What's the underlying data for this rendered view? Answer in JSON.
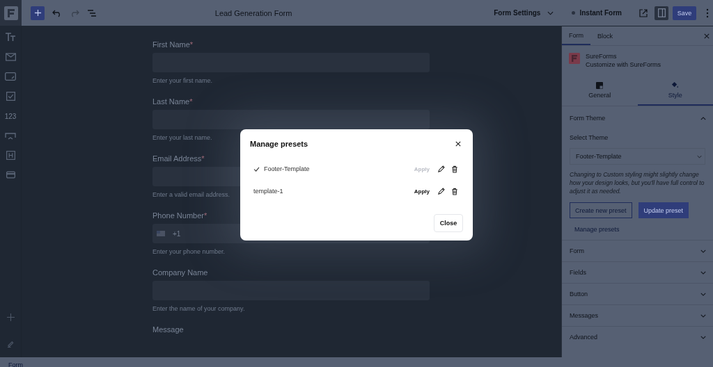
{
  "toolbar": {
    "title": "Lead Generation Form",
    "undo_disabled": false,
    "redo_disabled": true,
    "form_settings": "Form Settings",
    "instant_form": "Instant Form",
    "panel_toggle_on": true,
    "save": "Save"
  },
  "rail": [
    {
      "kind": "text"
    },
    {
      "kind": "mail"
    },
    {
      "kind": "textarea"
    },
    {
      "kind": "checkbox"
    },
    {
      "kind": "label",
      "text": "123"
    },
    {
      "kind": "dropdown"
    },
    {
      "kind": "heading"
    },
    {
      "kind": "payment"
    }
  ],
  "form": {
    "fields": [
      {
        "label": "First Name",
        "marker": "*",
        "kind": "text",
        "help": "Enter your first name."
      },
      {
        "label": "Last Name",
        "marker": "*",
        "kind": "text",
        "help": "Enter your last name."
      },
      {
        "label": "Email Address",
        "marker": "*",
        "kind": "text",
        "help": "Enter a valid email address."
      },
      {
        "label": "Phone Number",
        "marker": "*",
        "kind": "phone",
        "prefix": "+1",
        "help": "Enter your phone number."
      },
      {
        "label": "Company Name",
        "kind": "text",
        "help": "Enter the name of your company."
      },
      {
        "label": "Message",
        "kind": "label-only"
      }
    ]
  },
  "footer": {
    "breadcrumb": "Form"
  },
  "dialog": {
    "title": "Manage presets",
    "presets": [
      {
        "name": "Footer-Template",
        "selected": true,
        "apply": "Apply"
      },
      {
        "name": "template-1",
        "selected": false,
        "apply": "Apply"
      }
    ],
    "close_button": "Close"
  },
  "panel": {
    "tabs": [
      {
        "label": "Form",
        "selected": true
      },
      {
        "label": "Block",
        "selected": false
      }
    ],
    "plugin": {
      "name": "SureForms",
      "subtitle": "Customize with SureForms"
    },
    "mode_tabs": [
      {
        "label": "General",
        "selected": false,
        "kind": "general"
      },
      {
        "label": "Style",
        "selected": true,
        "kind": "style"
      }
    ],
    "theme_section": {
      "title": "Form Theme",
      "expanded": true,
      "select_label": "Select Theme",
      "select_value": "Footer-Template",
      "note": "Changing to Custom styling might slightly change how your design looks, but you'll have full control to adjust it as needed.",
      "create_button": "Create new preset",
      "update_button": "Update preset",
      "manage_link": "Manage presets"
    },
    "sections": [
      {
        "title": "Form",
        "expanded": false
      },
      {
        "title": "Fields",
        "expanded": false
      },
      {
        "title": "Button",
        "expanded": false
      },
      {
        "title": "Messages",
        "expanded": false
      },
      {
        "title": "Advanced",
        "expanded": false
      }
    ]
  }
}
